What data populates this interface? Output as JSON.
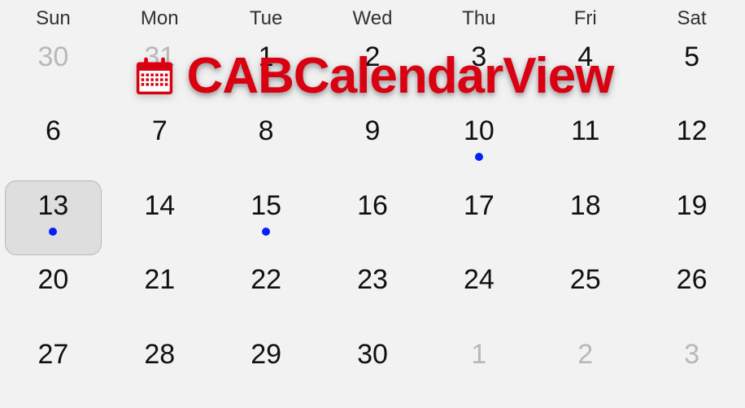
{
  "weekdays": [
    "Sun",
    "Mon",
    "Tue",
    "Wed",
    "Thu",
    "Fri",
    "Sat"
  ],
  "weeks": [
    [
      {
        "n": "30",
        "outside": true
      },
      {
        "n": "31",
        "outside": true
      },
      {
        "n": "1"
      },
      {
        "n": "2"
      },
      {
        "n": "3"
      },
      {
        "n": "4"
      },
      {
        "n": "5"
      }
    ],
    [
      {
        "n": "6"
      },
      {
        "n": "7"
      },
      {
        "n": "8"
      },
      {
        "n": "9"
      },
      {
        "n": "10",
        "hasEvent": true
      },
      {
        "n": "11"
      },
      {
        "n": "12"
      }
    ],
    [
      {
        "n": "13",
        "selected": true,
        "hasEvent": true
      },
      {
        "n": "14"
      },
      {
        "n": "15",
        "hasEvent": true
      },
      {
        "n": "16"
      },
      {
        "n": "17"
      },
      {
        "n": "18"
      },
      {
        "n": "19"
      }
    ],
    [
      {
        "n": "20"
      },
      {
        "n": "21"
      },
      {
        "n": "22"
      },
      {
        "n": "23"
      },
      {
        "n": "24"
      },
      {
        "n": "25"
      },
      {
        "n": "26"
      }
    ],
    [
      {
        "n": "27"
      },
      {
        "n": "28"
      },
      {
        "n": "29"
      },
      {
        "n": "30"
      },
      {
        "n": "1",
        "outside": true
      },
      {
        "n": "2",
        "outside": true
      },
      {
        "n": "3",
        "outside": true
      }
    ]
  ],
  "overlay": {
    "title": "CABCalendarView",
    "iconColor": "#d90011"
  },
  "colors": {
    "eventDot": "#0020ff",
    "selectedBg": "#dedede",
    "selectedBorder": "#b7b7b7",
    "text": "#111111",
    "outsideText": "#b8b8b8",
    "brand": "#d90011"
  }
}
